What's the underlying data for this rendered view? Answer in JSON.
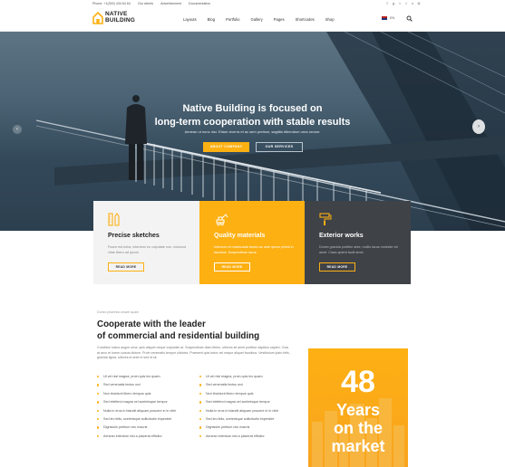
{
  "topbar": {
    "phone": "Phone: +1(300) 434 64 64",
    "links": [
      "Our clients",
      "Advertisement",
      "Documentation"
    ],
    "social_icons": [
      "facebook-icon",
      "google-plus-icon",
      "twitter-icon",
      "twitter-icon",
      "vimeo-icon",
      "instagram-icon"
    ]
  },
  "header": {
    "logo_line1": "NATIVE",
    "logo_line2": "BUILDING",
    "nav": [
      "Layouts",
      "Blog",
      "Portfolio",
      "Gallery",
      "Pages",
      "Shortcodes",
      "Shop"
    ],
    "language": "EN"
  },
  "hero": {
    "title_line1": "Native Building is focused on",
    "title_line2": "long-term cooperation with stable results",
    "subtitle": "Aenean ut nunc nisi. Etiam viverra et ac sem pretium, sagittis bibendum urna ornare.",
    "primary_button": "ABOUT COMPANY",
    "secondary_button": "OUR SERVICES"
  },
  "features": [
    {
      "title": "Precise sketches",
      "text": "Fusce est tortor, interdum eu vulputate non, euismod vitae libero ad ipsum.",
      "button": "READ MORE",
      "icon": "pencil-ruler-icon"
    },
    {
      "title": "Quality materials",
      "text": "Interdum et malesuada fames ac ante ipsum primis in faucibus. Suspendisse lacus.",
      "button": "READ MORE",
      "icon": "excavator-icon"
    },
    {
      "title": "Exterior works",
      "text": "Donec gravida porttitor ante, mollis lacus molestie vel amet. Class aptent taciti amet.",
      "button": "READ MORE",
      "icon": "paint-roller-icon"
    }
  ],
  "about": {
    "eyebrow": "Donec pharetra ornare quam",
    "title_line1": "Cooperate with the leader",
    "title_line2": "of commercial and residential building",
    "text": "Curabitur luctus augue urna, quis aliquet neque vulputate at. Suspendisse diam libero, ultrices sit amet porttitor dapibus sapien. Cras at arcu et lorem cursus dictum. Proin venenatis tempor ultricies. Praesent quis tortor vel neque aliquet faucibus. Vestibulum justo felis, gravida ligula, ultrices et ante id sed id sit.",
    "list_left": [
      "Ut vel nisl magna, proin quis leo quam",
      "Sed venenatis lectus orci",
      "Non tincidunt libero tempus quis",
      "Sed eleifend magna vel scelerisque tempor",
      "Nulla in eros in blandit aliquam posuere in in nibh",
      "Sed leo felis, scelerisque sollicitudin imperdiet",
      "Dignissim pretium nec mauris",
      "Aenean interdum nisi a placerat efficitur"
    ],
    "list_right": [
      "Ut vel nisl magna, proin quis leo quam",
      "Sed venenatis lectus orci",
      "Non tincidunt libero tempus quis",
      "Sed eleifend magna vel scelerisque tempor",
      "Nulla in eros in blandit aliquam posuere in in nibh",
      "Sed leo felis, scelerisque sollicitudin imperdiet",
      "Dignissim pretium nec mauris",
      "Aenean interdum nisi a placerat efficitur"
    ]
  },
  "stats": {
    "number": "48",
    "label_line1": "Years",
    "label_line2": "on the",
    "label_line3": "market"
  },
  "colors": {
    "accent": "#fdb012",
    "dark": "#3f4247",
    "light_card": "#f3f3f3"
  }
}
